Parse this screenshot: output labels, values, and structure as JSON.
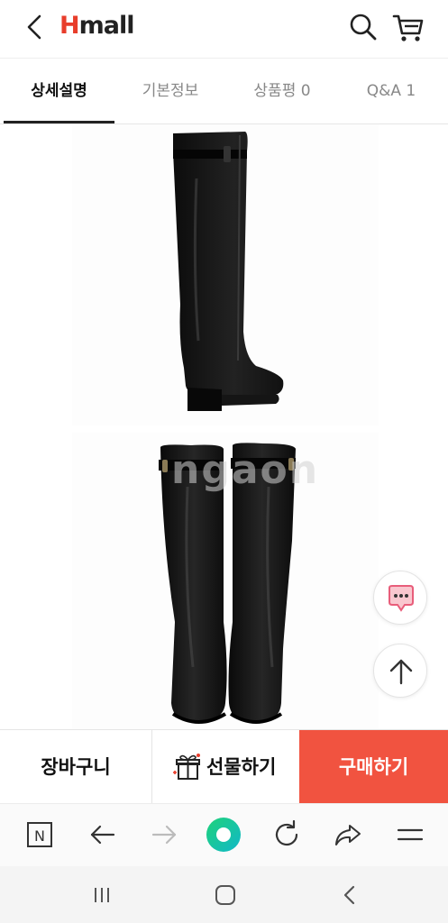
{
  "header": {
    "logo_prefix": "H",
    "logo_suffix": "mall",
    "back_icon": "chevron-left-icon",
    "search_icon": "search-icon",
    "cart_icon": "cart-icon"
  },
  "tabs": [
    {
      "label": "상세설명",
      "active": true
    },
    {
      "label": "기본정보",
      "active": false
    },
    {
      "label": "상품평 0",
      "active": false
    },
    {
      "label": "Q&A 1",
      "active": false
    }
  ],
  "main": {
    "watermark": "ngaon"
  },
  "floating": {
    "chat_icon": "chat-bubble-icon",
    "top_icon": "arrow-up-icon"
  },
  "action_bar": {
    "cart_label": "장바구니",
    "gift_label": "선물하기",
    "buy_label": "구매하기",
    "buy_color": "#f15340"
  },
  "browser_bar": {
    "icons": [
      "n-home-icon",
      "arrow-left-icon",
      "arrow-right-icon",
      "green-circle-icon",
      "refresh-icon",
      "share-icon",
      "menu-icon"
    ]
  },
  "system_nav": {
    "icons": [
      "recent-apps-icon",
      "home-icon",
      "back-icon"
    ]
  }
}
